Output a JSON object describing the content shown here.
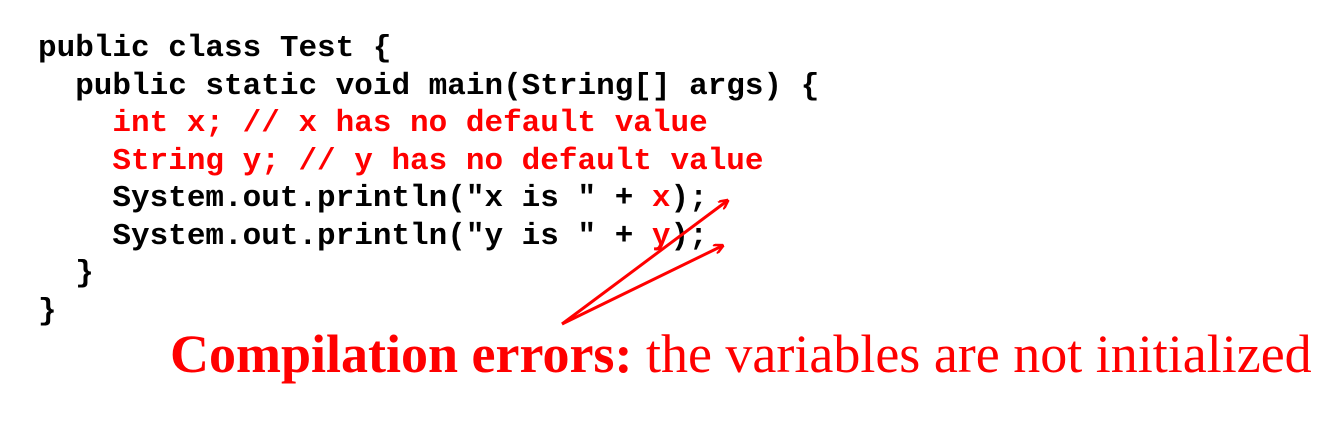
{
  "code": {
    "line1": "public class Test {",
    "line2": "  public static void main(String[] args) {",
    "line3": "    int x; // x has no default value",
    "line4": "    String y; // y has no default value",
    "line5_prefix": "    System.out.println(\"x is \" + ",
    "line5_var": "x",
    "line5_suffix": ");",
    "line6_prefix": "    System.out.println(\"y is \" + ",
    "line6_var": "y",
    "line6_suffix": ");",
    "line7": "  }",
    "line8": "}"
  },
  "annotation": {
    "bold_text": "Compilation errors:",
    "normal_text": " the variables are not initialized"
  },
  "colors": {
    "code": "#000000",
    "highlight": "#ff0000",
    "background": "#ffffff"
  }
}
